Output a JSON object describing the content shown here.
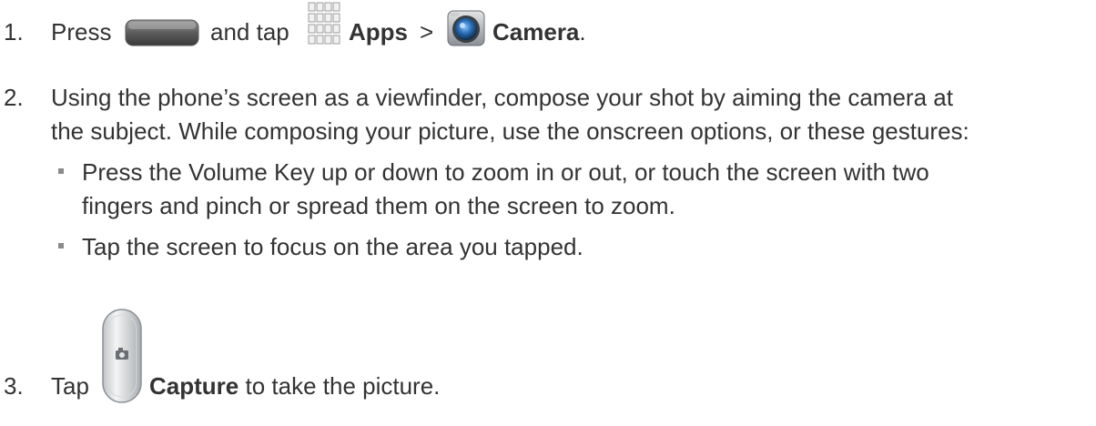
{
  "steps": [
    {
      "number": "1.",
      "text_press": "Press",
      "text_and_tap": "and tap",
      "apps_label": "Apps",
      "separator": ">",
      "camera_label": "Camera",
      "end": "."
    },
    {
      "number": "2.",
      "line1": "Using the phone’s screen as a viewfinder, compose your shot by aiming the camera at",
      "line2": "the subject. While composing your picture, use the onscreen options, or these gestures:",
      "bullets": [
        {
          "line1": "Press the Volume Key up or down to zoom in or out, or touch the screen with two",
          "line2": "fingers and pinch or spread them on the screen to zoom."
        },
        {
          "line1": "Tap the screen to focus on the area you tapped."
        }
      ]
    },
    {
      "number": "3.",
      "text_tap": "Tap",
      "capture_label": "Capture",
      "text_rest": "to take the picture."
    }
  ],
  "icons": {
    "home_key": "home-key-icon",
    "apps": "apps-grid-icon",
    "camera": "camera-app-icon",
    "capture": "capture-button-icon"
  },
  "colors": {
    "text": "#333333",
    "bullet": "#8a8a8a"
  }
}
